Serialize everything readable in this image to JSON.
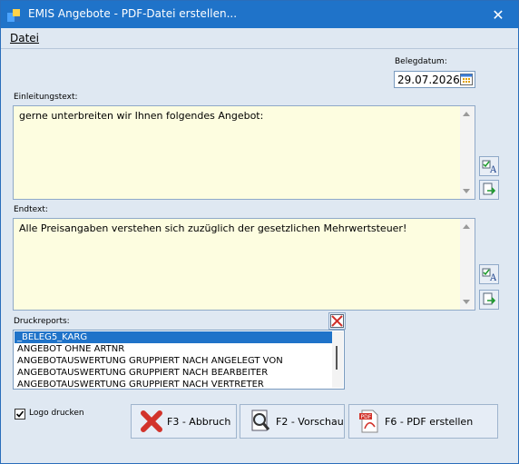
{
  "window": {
    "title": "EMIS Angebote - PDF-Datei erstellen..."
  },
  "menu": {
    "items": [
      "Datei"
    ]
  },
  "belegdatum": {
    "label": "Belegdatum:",
    "value": "29.07.2026"
  },
  "einleitung": {
    "label": "Einleitungstext:",
    "text": "gerne unterbreiten wir Ihnen folgendes Angebot:"
  },
  "endtext": {
    "label": "Endtext:",
    "text": "Alle Preisangaben verstehen sich zuzüglich der gesetzlichen Mehrwertsteuer!"
  },
  "reports": {
    "label": "Druckreports:",
    "items": [
      "_BELEG5_KARG",
      "ANGEBOT OHNE ARTNR",
      "ANGEBOTAUSWERTUNG GRUPPIERT NACH ANGELEGT VON",
      "ANGEBOTAUSWERTUNG GRUPPIERT NACH BEARBEITER",
      "ANGEBOTAUSWERTUNG GRUPPIERT NACH VERTRETER"
    ],
    "selected_index": 0
  },
  "logo": {
    "label": "Logo drucken",
    "checked": true
  },
  "buttons": {
    "abbruch": "F3 - Abbruch",
    "vorschau": "F2 - Vorschau",
    "pdf": "F6 - PDF erstellen"
  },
  "colors": {
    "titlebar": "#1f73c9",
    "memo_bg": "#fdfde0",
    "selection": "#1f73c9",
    "window_bg": "#dfe8f2"
  }
}
